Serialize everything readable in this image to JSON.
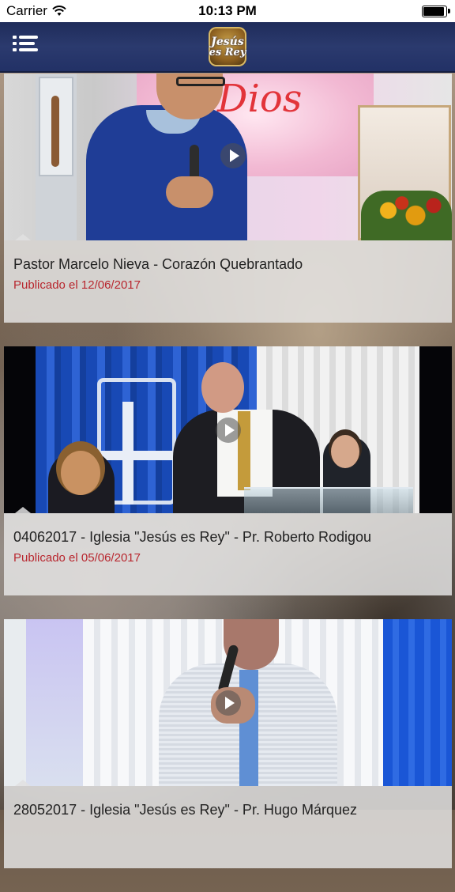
{
  "status_bar": {
    "carrier": "Carrier",
    "time": "10:13 PM"
  },
  "header": {
    "logo_line1": "Jesús",
    "logo_line2": "es Rey"
  },
  "videos": [
    {
      "title": "Pastor Marcelo Nieva - Corazón Quebrantado",
      "date": "Publicado el 12/06/2017"
    },
    {
      "title": "04062017 - Iglesia \"Jesús es Rey\" - Pr. Roberto Rodigou",
      "date": "Publicado el 05/06/2017"
    },
    {
      "title": "28052017 - Iglesia \"Jesús es Rey\" - Pr. Hugo Márquez",
      "date": ""
    }
  ],
  "colors": {
    "nav_bar": "#2b3a6e",
    "date_text": "#b8262e"
  }
}
